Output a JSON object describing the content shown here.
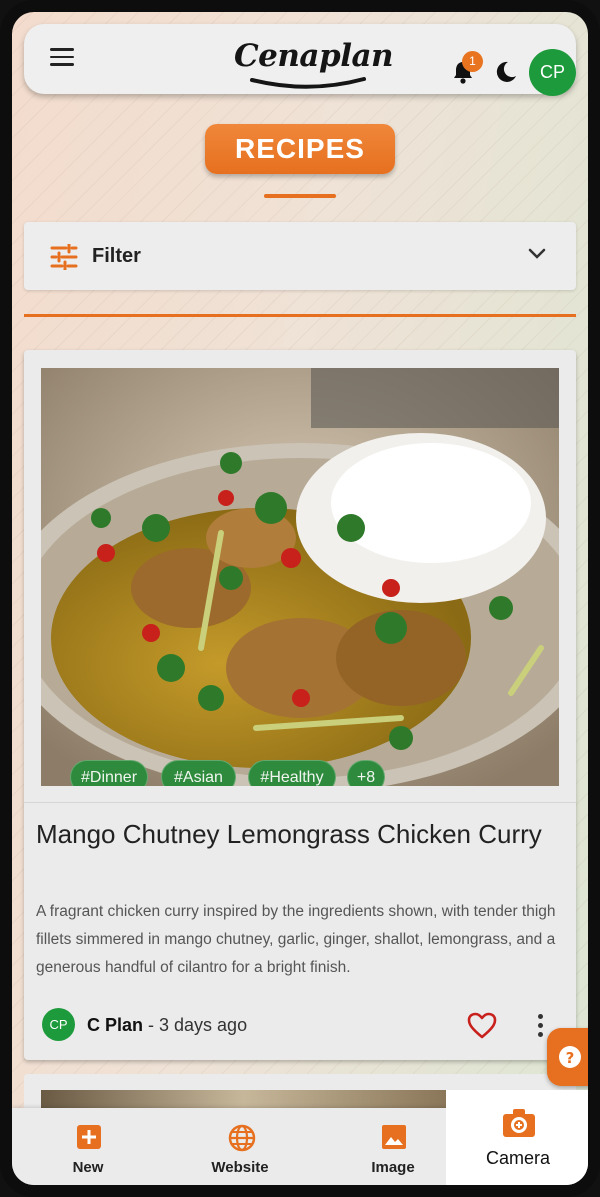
{
  "header": {
    "logo_text": "Cenaplan",
    "notification_count": "1",
    "user_initials": "CP"
  },
  "page": {
    "title": "RECIPES"
  },
  "filter": {
    "label": "Filter"
  },
  "recipe": {
    "tags": [
      "#Dinner",
      "#Asian",
      "#Healthy",
      "+8"
    ],
    "title": "Mango Chutney Lemongrass Chicken Curry",
    "description": "A fragrant chicken curry inspired by the ingredients shown, with tender thigh fillets simmered in mango chutney, garlic, ginger, shallot, lemongrass, and a generous handful of cilantro for a bright finish.",
    "author_initials": "CP",
    "author_name": "C Plan",
    "posted": " - 3 days ago"
  },
  "bottom_nav": {
    "items": [
      {
        "label": "New",
        "icon": "plus-square-icon"
      },
      {
        "label": "Website",
        "icon": "globe-icon"
      },
      {
        "label": "Image",
        "icon": "image-icon"
      },
      {
        "label": "Camera",
        "icon": "camera-icon",
        "active": true
      }
    ]
  },
  "colors": {
    "accent": "#e6701f",
    "green": "#1d9a3b",
    "tag_green": "#2e8b3d"
  }
}
